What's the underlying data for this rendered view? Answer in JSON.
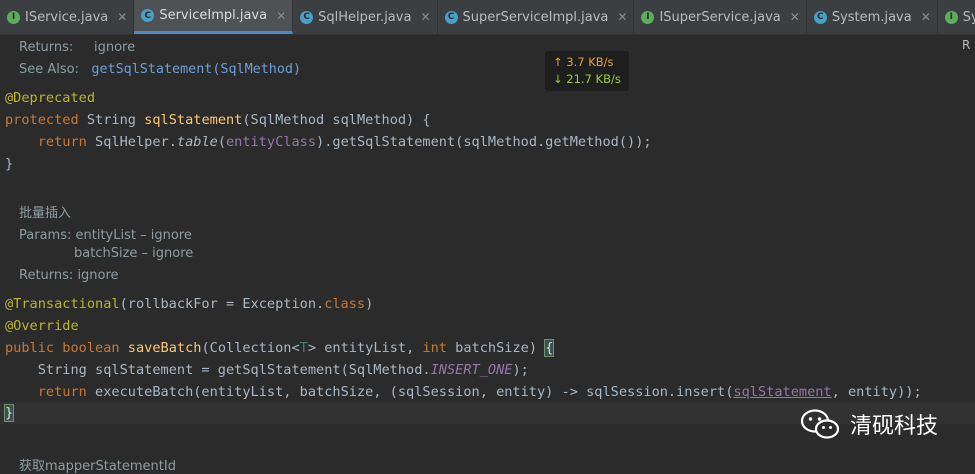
{
  "tabs": [
    {
      "label": "IService.java",
      "icon": "interface-icon",
      "active": false
    },
    {
      "label": "ServiceImpl.java",
      "icon": "class-icon",
      "active": true
    },
    {
      "label": "SqlHelper.java",
      "icon": "class-icon",
      "active": false
    },
    {
      "label": "SuperServiceImpl.java",
      "icon": "class-icon",
      "active": false
    },
    {
      "label": "ISuperService.java",
      "icon": "interface-icon",
      "active": false
    },
    {
      "label": "System.java",
      "icon": "class-icon",
      "active": false
    },
    {
      "label": "SysDictMapper.jav",
      "icon": "interface-icon",
      "active": false
    }
  ],
  "side_letter": "R",
  "doc1": {
    "returns_label": "Returns:",
    "returns_value": "ignore",
    "see_also_label": "See Also:",
    "see_also_value": "getSqlStatement(SqlMethod)"
  },
  "code1": {
    "annotation": "@Deprecated",
    "kw_protected": "protected",
    "type_string": " String ",
    "method_name": "sqlStatement",
    "params": "(SqlMethod sqlMethod) {",
    "kw_return": "return",
    "helper": " SqlHelper.",
    "table_call": "table",
    "open_paren": "(",
    "entity_class": "entityClass",
    "rest": ").getSqlStatement(sqlMethod.getMethod());",
    "close_brace": "}"
  },
  "doc2": {
    "summary": "批量插入",
    "params_label": "Params:",
    "param1": "entityList – ignore",
    "param2": "batchSize – ignore",
    "returns_label": "Returns:",
    "returns_value": "ignore"
  },
  "code2": {
    "annotation_transactional": "@Transactional",
    "transactional_args_open": "(rollbackFor = Exception.",
    "kw_class": "class",
    "transactional_args_close": ")",
    "annotation_override": "@Override",
    "kw_public": "public",
    "kw_boolean": " boolean ",
    "method_name": "saveBatch",
    "params_a": "(Collection<",
    "type_param": "T",
    "params_b": "> entityList, ",
    "kw_int": "int",
    "params_c": " batchSize) ",
    "open_brace": "{",
    "line1_a": "String sqlStatement = getSqlStatement(SqlMethod.",
    "insert_one": "INSERT_ONE",
    "line1_b": ");",
    "kw_return": "return",
    "line2_a": " executeBatch(entityList, batchSize, (sqlSession, entity) -> sqlSession.insert(",
    "line2_var": "sqlStatement",
    "line2_b": ", entity));",
    "close_brace": "}"
  },
  "doc3": {
    "summary": "获取mapperStatementId"
  },
  "netspeed": {
    "upload": "↑ 3.7 KB/s",
    "download": "↓ 21.7 KB/s"
  },
  "watermark": {
    "text": "清砚科技"
  }
}
